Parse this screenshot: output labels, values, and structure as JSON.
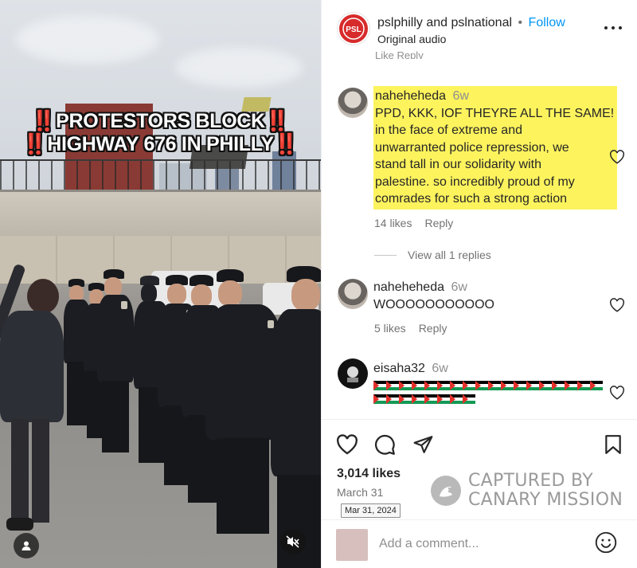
{
  "media": {
    "overlay_line1_prefix": "‼️",
    "overlay_line1_text": "PROTESTORS BLOCK",
    "overlay_line1_suffix": "‼️",
    "overlay_line2_prefix": "‼️",
    "overlay_line2_text": "HIGHWAY 676 IN PHILLY",
    "overlay_line2_suffix": "‼️",
    "user_tag_icon": "person-icon",
    "mute_icon": "speaker-muted-icon"
  },
  "post": {
    "header": {
      "account_primary": "pslphilly",
      "joiner": "and",
      "account_secondary": "pslnational",
      "separator": "•",
      "follow_label": "Follow",
      "audio_label": "Original audio",
      "avatar_text": "PSL",
      "more_icon": "more-horizontal-icon"
    },
    "cut_actions": "Like   Reply",
    "comments": [
      {
        "username": "naheheheda",
        "time": "6w",
        "text_lines": [
          "PPD, KKK, IOF THEYRE ALL THE SAME!",
          "in the face of extreme and",
          "unwarranted police repression, we",
          "stand tall in our solidarity with",
          "palestine. so incredibly proud of my",
          "comrades for such a strong action"
        ],
        "likes": "14 likes",
        "reply_label": "Reply",
        "view_replies": "View all 1 replies",
        "highlighted": true
      },
      {
        "username": "naheheheda",
        "time": "6w",
        "text": "WOOOOOOOOOOO",
        "likes": "5 likes",
        "reply_label": "Reply"
      },
      {
        "username": "eisaha32",
        "time": "6w",
        "flag_rows": [
          18,
          8
        ]
      }
    ],
    "likes_count": "3,014 likes",
    "date": "March 31",
    "date_tooltip": "Mar 31, 2024",
    "watermark_line1": "CAPTURED BY",
    "watermark_line2": "CANARY MISSION",
    "comment_placeholder": "Add a comment...",
    "icons": {
      "like": "heart-icon",
      "comment": "comment-bubble-icon",
      "share": "paper-plane-icon",
      "save": "bookmark-icon",
      "emoji": "emoji-smile-icon"
    },
    "colors": {
      "follow": "#0095f6",
      "highlight": "#fdf35d",
      "psl_red": "#d72b2b"
    }
  }
}
